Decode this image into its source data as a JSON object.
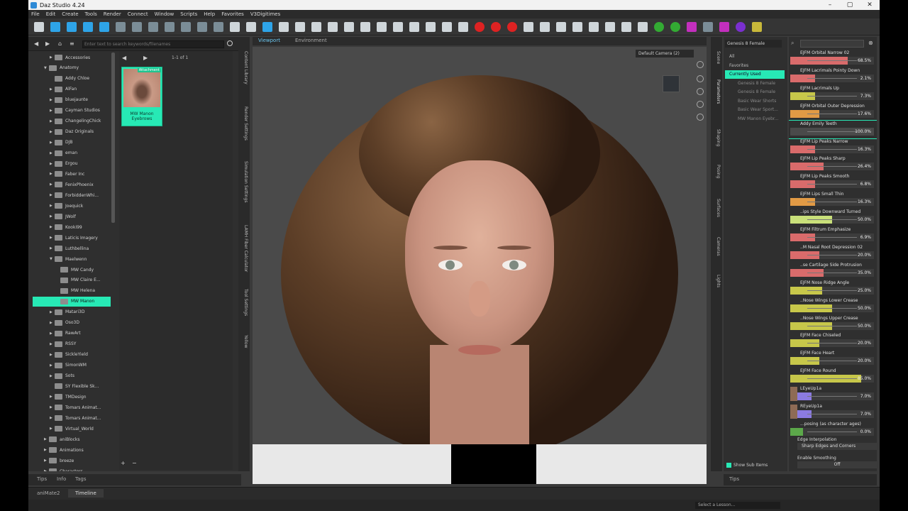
{
  "window": {
    "title": "Daz Studio 4.24",
    "minimize": "–",
    "maximize": "▢",
    "close": "✕"
  },
  "menu": [
    "File",
    "Edit",
    "Create",
    "Tools",
    "Render",
    "Connect",
    "Window",
    "Scripts",
    "Help",
    "Favorites",
    "V3Digitimes"
  ],
  "library": {
    "search_placeholder": "Enter text to search keywords/filenames",
    "count": "1-1 of 1",
    "tree": [
      {
        "label": "Accessories",
        "level": 1,
        "arrow": "▶"
      },
      {
        "label": "Anatomy",
        "level": 0,
        "arrow": "▼"
      },
      {
        "label": "Addy Chloe",
        "level": 1,
        "arrow": ""
      },
      {
        "label": "AlFan",
        "level": 1,
        "arrow": "▶"
      },
      {
        "label": "bluejaunte",
        "level": 1,
        "arrow": "▶"
      },
      {
        "label": "Cayman Studios",
        "level": 1,
        "arrow": "▶"
      },
      {
        "label": "ChangelingChick",
        "level": 1,
        "arrow": "▶"
      },
      {
        "label": "Daz Originals",
        "level": 1,
        "arrow": "▶"
      },
      {
        "label": "DJB",
        "level": 1,
        "arrow": "▶"
      },
      {
        "label": "eman",
        "level": 1,
        "arrow": "▶"
      },
      {
        "label": "Ergou",
        "level": 1,
        "arrow": "▶"
      },
      {
        "label": "Faber Inc",
        "level": 1,
        "arrow": "▶"
      },
      {
        "label": "FenixPhoenix",
        "level": 1,
        "arrow": "▶"
      },
      {
        "label": "ForbiddenWhi...",
        "level": 1,
        "arrow": "▶"
      },
      {
        "label": "Joequick",
        "level": 1,
        "arrow": "▶"
      },
      {
        "label": "JWolf",
        "level": 1,
        "arrow": "▶"
      },
      {
        "label": "Kooki99",
        "level": 1,
        "arrow": "▶"
      },
      {
        "label": "Laticis Imagery",
        "level": 1,
        "arrow": "▶"
      },
      {
        "label": "Luthbellina",
        "level": 1,
        "arrow": "▶"
      },
      {
        "label": "Maelwenn",
        "level": 1,
        "arrow": "▼"
      },
      {
        "label": "MW Candy",
        "level": 2,
        "arrow": ""
      },
      {
        "label": "MW Claire E...",
        "level": 2,
        "arrow": ""
      },
      {
        "label": "MW Helena",
        "level": 2,
        "arrow": ""
      },
      {
        "label": "MW Manon",
        "level": 2,
        "arrow": "",
        "selected": true
      },
      {
        "label": "Matari3D",
        "level": 1,
        "arrow": "▶"
      },
      {
        "label": "Oso3D",
        "level": 1,
        "arrow": "▶"
      },
      {
        "label": "RawArt",
        "level": 1,
        "arrow": "▶"
      },
      {
        "label": "RSSY",
        "level": 1,
        "arrow": "▶"
      },
      {
        "label": "SickleYield",
        "level": 1,
        "arrow": "▶"
      },
      {
        "label": "SimonWM",
        "level": 1,
        "arrow": "▶"
      },
      {
        "label": "Sots",
        "level": 1,
        "arrow": "▶"
      },
      {
        "label": "SY Flexible Sk...",
        "level": 1,
        "arrow": ""
      },
      {
        "label": "TMDesign",
        "level": 1,
        "arrow": "▶"
      },
      {
        "label": "Tomars Animat...",
        "level": 1,
        "arrow": "▶"
      },
      {
        "label": "Tomars Animat...",
        "level": 1,
        "arrow": "▶"
      },
      {
        "label": "Virtual_World",
        "level": 1,
        "arrow": "▶"
      },
      {
        "label": "aniBlocks",
        "level": 0,
        "arrow": "▶"
      },
      {
        "label": "Animations",
        "level": 0,
        "arrow": "▶"
      },
      {
        "label": "breeze",
        "level": 0,
        "arrow": "▶"
      },
      {
        "label": "Characters",
        "level": 0,
        "arrow": "▶"
      }
    ],
    "thumb": {
      "badge": "Attachment",
      "label": "MW Manon Eyebrows"
    },
    "add": "+",
    "remove": "−"
  },
  "side_tabs": [
    "Content Library",
    "Render Settings",
    "Simulation Settings",
    "LAMH Fiber Calculator",
    "Tool Settings",
    "Yellow"
  ],
  "viewport": {
    "tab_viewport": "Viewport",
    "tab_environment": "Environment",
    "camera": "Default Camera (2)"
  },
  "right_tabs": [
    "Scene",
    "Parameters",
    "Shaping",
    "Posing",
    "Surfaces",
    "Cameras",
    "Lights"
  ],
  "scene": {
    "figure_select": "Genesis 8 Female",
    "items": [
      {
        "label": "All",
        "current": false,
        "node": false
      },
      {
        "label": "Favorites",
        "current": false,
        "node": false
      },
      {
        "label": "Currently Used",
        "current": true,
        "node": false
      },
      {
        "label": "Genesis 8 Female",
        "current": false,
        "node": true
      },
      {
        "label": "Genesis 8 Female",
        "current": false,
        "node": true
      },
      {
        "label": "Basic Wear Shorts",
        "current": false,
        "node": true
      },
      {
        "label": "Basic Wear Sport...",
        "current": false,
        "node": true
      },
      {
        "label": "MW Manon Eyebr...",
        "current": false,
        "node": true
      }
    ],
    "show_sub_items": "Show Sub Items"
  },
  "params": {
    "list": [
      {
        "name": "EJFM Orbital Narrow 02",
        "value": "68.5%",
        "fill": 0.685,
        "color": "#d96b6b"
      },
      {
        "name": "EJFM Lacrimals Pointy Down",
        "value": "2.1%",
        "fill": 0.3,
        "color": "#d96b6b"
      },
      {
        "name": "EJFM Lacrimals Up",
        "value": "7.3%",
        "fill": 0.3,
        "color": "#c7c74a"
      },
      {
        "name": "EJFM Orbital Outer Depression",
        "value": "17.6%",
        "fill": 0.35,
        "color": "#e19a45"
      },
      {
        "name": "Addy Emily Teeth",
        "value": "100.0%",
        "fill": 1.0,
        "color": "#4a4a4a",
        "highlight": true
      },
      {
        "name": "EJFM Lip Peaks Narrow",
        "value": "16.3%",
        "fill": 0.3,
        "color": "#d96b6b"
      },
      {
        "name": "EJFM Lip Peaks Sharp",
        "value": "26.4%",
        "fill": 0.4,
        "color": "#d96b6b"
      },
      {
        "name": "EJFM Lip Peaks Smooth",
        "value": "6.8%",
        "fill": 0.3,
        "color": "#d96b6b"
      },
      {
        "name": "EJFM Lips Small Thin",
        "value": "16.3%",
        "fill": 0.3,
        "color": "#e19a45"
      },
      {
        "name": "..ips Style Downward Turned",
        "value": "50.0%",
        "fill": 0.5,
        "color": "#c9e07a"
      },
      {
        "name": "EJFM Filtrum Emphasize",
        "value": "6.9%",
        "fill": 0.3,
        "color": "#d96b6b"
      },
      {
        "name": "..M Nasal Root Depression 02",
        "value": "20.0%",
        "fill": 0.35,
        "color": "#d96b6b"
      },
      {
        "name": "..se Cartilage Side Protrusion",
        "value": "35.0%",
        "fill": 0.4,
        "color": "#d96b6b"
      },
      {
        "name": "EJFM Nose Ridge Angle",
        "value": "25.0%",
        "fill": 0.38,
        "color": "#c7c74a"
      },
      {
        "name": "..Nose Wings Lower Crease",
        "value": "50.0%",
        "fill": 0.5,
        "color": "#c7c74a"
      },
      {
        "name": "..Nose Wings Upper Crease",
        "value": "50.0%",
        "fill": 0.5,
        "color": "#c7c74a"
      },
      {
        "name": "EJFM Face Chiseled",
        "value": "20.0%",
        "fill": 0.35,
        "color": "#c7c74a"
      },
      {
        "name": "EJFM Face Heart",
        "value": "20.0%",
        "fill": 0.35,
        "color": "#c7c74a"
      },
      {
        "name": "EJFM Face Round",
        "value": "85.0%",
        "fill": 0.85,
        "color": "#c7c74a"
      },
      {
        "name": "LEyeUp1a",
        "value": "7.0%",
        "fill": 0.25,
        "color": "#8b7be0",
        "thumb": true
      },
      {
        "name": "REyeUp1a",
        "value": "7.0%",
        "fill": 0.25,
        "color": "#8b7be0",
        "thumb": true
      },
      {
        "name": "...posing (as character ages)",
        "value": "0.0%",
        "fill": 0.15,
        "color": "#5ca84a"
      }
    ],
    "edge_label": "Edge Interpolation",
    "edge_value": "Sharp Edges and Corners",
    "smoothing_label": "Enable Smoothing",
    "smoothing_value": "Off"
  },
  "bottom": {
    "tips": "Tips",
    "info": "Info",
    "tags": "Tags",
    "tips_right": "Tips",
    "tab_animate": "aniMate2",
    "tab_timeline": "Timeline",
    "lesson": "Select a Lesson..."
  }
}
